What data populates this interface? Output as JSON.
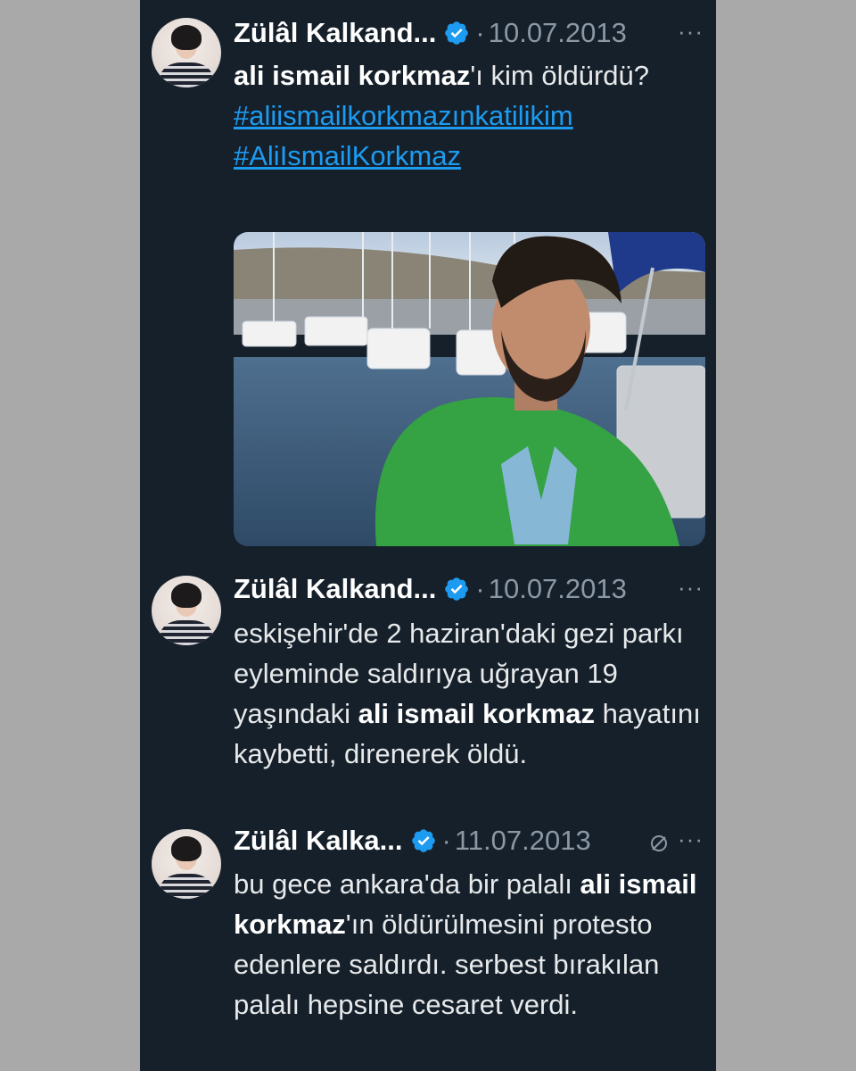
{
  "tweets": [
    {
      "author": "Zülâl Kalkand...",
      "separator": "·",
      "date": "10.07.2013",
      "more": "···",
      "text_parts": {
        "bold1": "ali ismail korkmaz",
        "rest1": "'ı kim öldürdü?"
      },
      "hashtags": [
        "#aliismailkorkmazınkatilikim",
        "#AliIsmailKorkmaz"
      ]
    },
    {
      "author": "Zülâl Kalkand...",
      "separator": "·",
      "date": "10.07.2013",
      "more": "···",
      "text_parts": {
        "pre": "eskişehir'de 2 haziran'daki gezi parkı eyleminde saldırıya uğrayan 19 yaşındaki ",
        "bold": "ali ismail korkmaz",
        "post": " hayatını kaybetti, direnerek öldü."
      }
    },
    {
      "author": "Zülâl Kalka...",
      "separator": "·",
      "date": "11.07.2013",
      "more": "···",
      "text_parts": {
        "pre": "bu gece ankara'da bir palalı ",
        "bold": "ali ismail korkmaz",
        "post": "'ın öldürülmesini protesto edenlere saldırdı. serbest bırakılan palalı hepsine cesaret verdi."
      }
    }
  ],
  "icons": {
    "verified": "verified-badge-icon",
    "edited": "edit-history-icon",
    "more": "more-options-icon"
  },
  "colors": {
    "background": "#15202b",
    "frame": "#a9a9a9",
    "link": "#1d9bf0",
    "verified": "#1d9bf0",
    "muted": "#8b98a5"
  }
}
